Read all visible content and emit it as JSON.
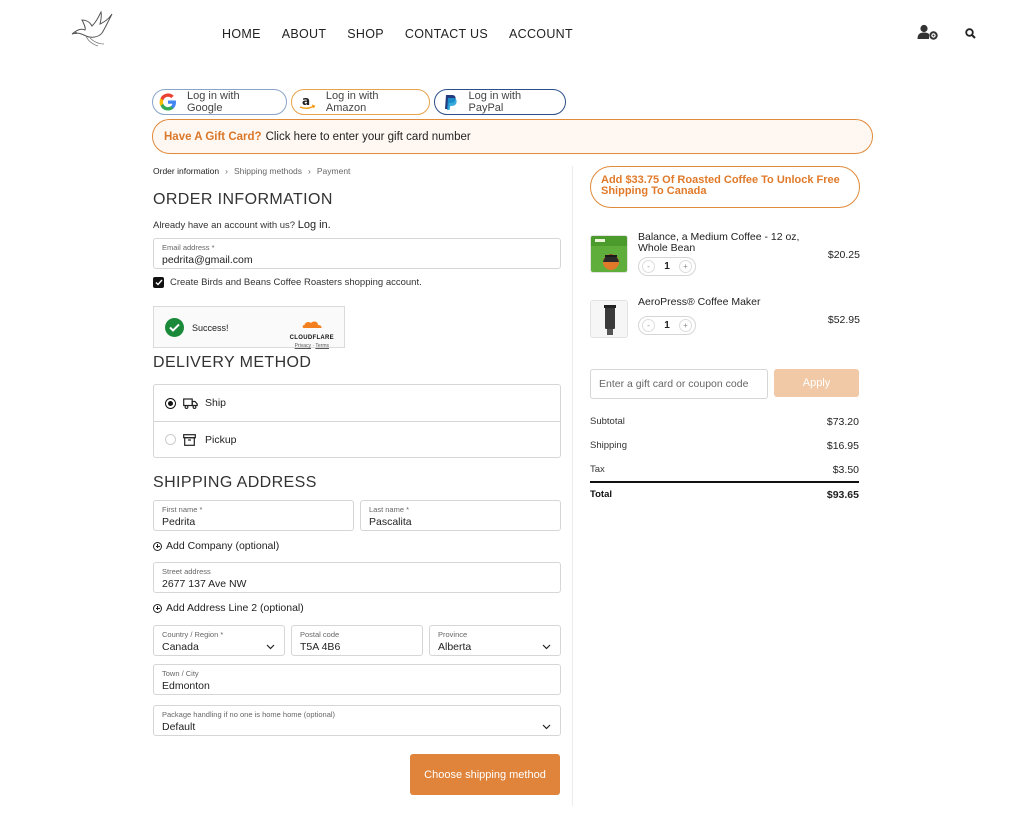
{
  "nav": {
    "items": [
      "HOME",
      "ABOUT",
      "SHOP",
      "CONTACT US",
      "ACCOUNT"
    ],
    "icons": [
      "account-settings-icon",
      "search-icon"
    ]
  },
  "express": {
    "google": "Log in with Google",
    "amazon": "Log in with Amazon",
    "paypal": "Log in with PayPal"
  },
  "gift_card": {
    "highlight": "Have A Gift Card?",
    "text": "Click here to enter your gift card number"
  },
  "breadcrumb": [
    "Order information",
    "Shipping methods",
    "Payment"
  ],
  "order_info": {
    "heading": "ORDER INFORMATION",
    "account_prompt": "Already have an account with us?",
    "login_link": "Log in.",
    "email_label": "Email address *",
    "email_value": "pedrita@gmail.com",
    "create_account_label": "Create Birds and Beans Coffee Roasters shopping account.",
    "create_account_checked": true
  },
  "captcha": {
    "status": "Success!",
    "brand": "CLOUDFLARE",
    "privacy": "Privacy",
    "sep": "·",
    "terms": "Terms"
  },
  "delivery": {
    "heading": "DELIVERY METHOD",
    "options": [
      {
        "label": "Ship",
        "icon": "truck-icon",
        "selected": true
      },
      {
        "label": "Pickup",
        "icon": "store-box-icon",
        "selected": false
      }
    ]
  },
  "shipping": {
    "heading": "SHIPPING ADDRESS",
    "first_name_label": "First name *",
    "first_name": "Pedrita",
    "last_name_label": "Last name *",
    "last_name": "Pascalita",
    "add_company": "Add Company (optional)",
    "street_label": "Street address",
    "street": "2677 137 Ave NW",
    "add_line2": "Add Address Line 2 (optional)",
    "country_label": "Country / Region *",
    "country": "Canada",
    "postal_label": "Postal code",
    "postal": "T5A 4B6",
    "province_label": "Province",
    "province": "Alberta",
    "city_label": "Town / City",
    "city": "Edmonton",
    "package_label": "Package handling if no one is home home (optional)",
    "package": "Default",
    "submit": "Choose shipping method"
  },
  "cart": {
    "free_shipping_banner": "Add $33.75 Of Roasted Coffee To Unlock Free Shipping To Canada",
    "items": [
      {
        "name": "Balance, a Medium Coffee - 12 oz, Whole Bean",
        "qty": "1",
        "price": "$20.25",
        "minus": "-",
        "plus": "+"
      },
      {
        "name": "AeroPress® Coffee Maker",
        "qty": "1",
        "price": "$52.95",
        "minus": "-",
        "plus": "+"
      }
    ],
    "coupon_placeholder": "Enter a gift card or coupon code",
    "apply": "Apply",
    "summary": {
      "subtotal_label": "Subtotal",
      "subtotal": "$73.20",
      "shipping_label": "Shipping",
      "shipping": "$16.95",
      "tax_label": "Tax",
      "tax": "$3.50",
      "total_label": "Total",
      "total": "$93.65"
    }
  },
  "colors": {
    "accent": "#e0843b",
    "accent_light": "#f1c9a6",
    "success": "#1a8a3a"
  }
}
